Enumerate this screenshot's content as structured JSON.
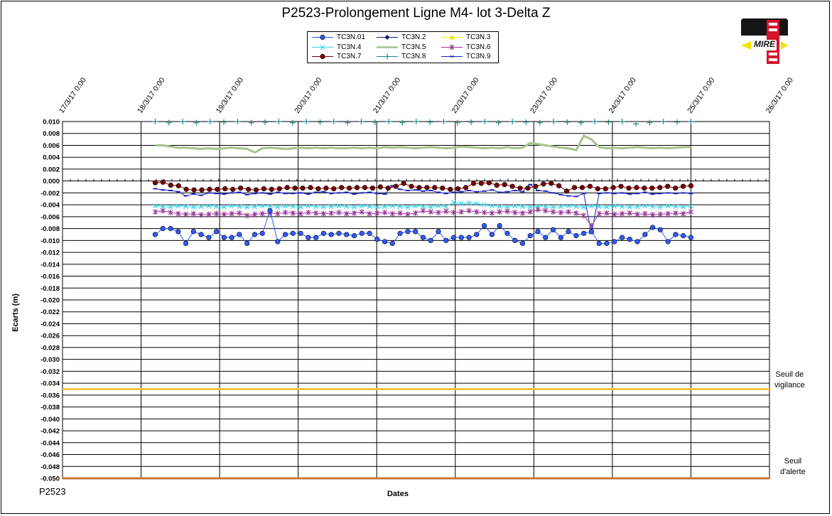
{
  "chart_data": {
    "type": "line",
    "title": "P2523-Prolongement  Ligne  M4- lot 3-Delta Z",
    "xlabel": "Dates",
    "ylabel": "Ecarts (m)",
    "x_ticks": [
      "17/3/17 0:00",
      "18/3/17 0:00",
      "19/3/17 0:00",
      "20/3/17 0:00",
      "21/3/17 0:00",
      "22/3/17 0:00",
      "23/3/17 0:00",
      "24/3/17 0:00",
      "25/3/17 0:00",
      "26/3/17 0:00"
    ],
    "xlim": [
      0,
      9
    ],
    "ylim": [
      -0.05,
      0.01
    ],
    "y_step": 0.002,
    "grid": true,
    "legend_position": "top-center",
    "thresholds": [
      {
        "name": "Seuil de vigilance",
        "label_line1": "Seuil de",
        "label_line2": "vigilance",
        "value": -0.035,
        "color": "#f5c242"
      },
      {
        "name": "Seuil d'alerte",
        "label_line1": "Seuil",
        "label_line2": "d'alerte",
        "value": -0.05,
        "color": "#c8783c"
      }
    ],
    "series": [
      {
        "name": "TC3N.01",
        "color": "#2f5bff",
        "marker": "circle",
        "line": true,
        "y": [
          -0.009,
          -0.008,
          -0.008,
          -0.0085,
          -0.0105,
          -0.0085,
          -0.009,
          -0.0095,
          -0.0085,
          -0.0095,
          -0.0095,
          -0.009,
          -0.0105,
          -0.009,
          -0.0088,
          -0.005,
          -0.0102,
          -0.009,
          -0.0088,
          -0.0088,
          -0.0095,
          -0.0095,
          -0.0088,
          -0.009,
          -0.0088,
          -0.009,
          -0.0092,
          -0.0088,
          -0.0088,
          -0.0098,
          -0.0102,
          -0.0105,
          -0.0088,
          -0.0085,
          -0.0085,
          -0.0095,
          -0.01,
          -0.0085,
          -0.01,
          -0.0095,
          -0.0095,
          -0.0095,
          -0.009,
          -0.0075,
          -0.009,
          -0.0075,
          -0.0088,
          -0.01,
          -0.0105,
          -0.0092,
          -0.0085,
          -0.0095,
          -0.0082,
          -0.0095,
          -0.0085,
          -0.0092,
          -0.0088,
          -0.0085,
          -0.0105,
          -0.0105,
          -0.0102,
          -0.0095,
          -0.0098,
          -0.0102,
          -0.009,
          -0.0078,
          -0.0082,
          -0.0102,
          -0.009,
          -0.0092,
          -0.0095
        ]
      },
      {
        "name": "TC3N.2",
        "color": "#0b1f7a",
        "marker": "diamond",
        "line": true,
        "y": []
      },
      {
        "name": "TC3N.3",
        "color": "#f2e400",
        "marker": "triangle",
        "line": true,
        "y": []
      },
      {
        "name": "TC3N.4",
        "color": "#36d6f0",
        "marker": "x",
        "line": true,
        "y": [
          -0.0042,
          -0.0043,
          -0.0044,
          -0.0042,
          -0.0043,
          -0.0044,
          -0.0043,
          -0.0042,
          -0.0043,
          -0.0044,
          -0.0042,
          -0.0043,
          -0.0044,
          -0.0043,
          -0.0042,
          -0.0043,
          -0.0044,
          -0.0042,
          -0.0043,
          -0.0044,
          -0.0042,
          -0.0043,
          -0.0044,
          -0.0043,
          -0.0042,
          -0.0043,
          -0.0044,
          -0.0042,
          -0.0043,
          -0.0044,
          -0.0043,
          -0.0042,
          -0.0043,
          -0.0044,
          -0.0042,
          -0.0043,
          -0.0044,
          -0.0042,
          -0.0043,
          -0.0036,
          -0.0038,
          -0.0037,
          -0.0038,
          -0.004,
          -0.0042,
          -0.0043,
          -0.0044,
          -0.0042,
          -0.0043,
          -0.0044,
          -0.0042,
          -0.0043,
          -0.0044,
          -0.0043,
          -0.0042,
          -0.0043,
          -0.0044,
          -0.0042,
          -0.0043,
          -0.0044,
          -0.0042,
          -0.0043,
          -0.0044,
          -0.0043,
          -0.0042,
          -0.0043,
          -0.0044,
          -0.0042,
          -0.0043,
          -0.0044,
          -0.0042
        ]
      },
      {
        "name": "TC3N.5",
        "color": "#a4c48a",
        "marker": "none",
        "line": true,
        "y": [
          0.006,
          0.006,
          0.0058,
          0.0056,
          0.0056,
          0.0055,
          0.0054,
          0.0055,
          0.0054,
          0.0055,
          0.0056,
          0.0055,
          0.0054,
          0.0048,
          0.0055,
          0.0056,
          0.0055,
          0.0054,
          0.0055,
          0.0056,
          0.0055,
          0.0056,
          0.0055,
          0.0056,
          0.0055,
          0.0055,
          0.0056,
          0.0055,
          0.0056,
          0.0055,
          0.0057,
          0.0056,
          0.0057,
          0.0056,
          0.0055,
          0.0056,
          0.0057,
          0.0056,
          0.0055,
          0.0056,
          0.0058,
          0.0057,
          0.0056,
          0.0055,
          0.0056,
          0.0055,
          0.0057,
          0.0055,
          0.0056,
          0.0064,
          0.0062,
          0.006,
          0.0058,
          0.0056,
          0.0055,
          0.0052,
          0.0076,
          0.007,
          0.0057,
          0.0055,
          0.0056,
          0.0055,
          0.0056,
          0.0057,
          0.0056,
          0.0055,
          0.0056,
          0.0055,
          0.0056,
          0.0057,
          0.0057
        ]
      },
      {
        "name": "TC3N.6",
        "color": "#993399",
        "marker": "star",
        "line": true,
        "y": [
          -0.0052,
          -0.005,
          -0.0053,
          -0.0055,
          -0.0056,
          -0.0055,
          -0.0057,
          -0.0056,
          -0.0055,
          -0.0056,
          -0.0055,
          -0.0054,
          -0.0058,
          -0.0056,
          -0.0055,
          -0.0054,
          -0.0055,
          -0.0053,
          -0.0054,
          -0.0055,
          -0.0053,
          -0.0054,
          -0.0055,
          -0.0054,
          -0.0053,
          -0.0055,
          -0.0054,
          -0.0052,
          -0.0055,
          -0.0054,
          -0.0053,
          -0.0055,
          -0.0054,
          -0.0056,
          -0.0054,
          -0.005,
          -0.0052,
          -0.0053,
          -0.0051,
          -0.0053,
          -0.0052,
          -0.005,
          -0.0052,
          -0.0053,
          -0.0054,
          -0.0052,
          -0.0051,
          -0.0053,
          -0.0054,
          -0.0052,
          -0.0048,
          -0.005,
          -0.0052,
          -0.0053,
          -0.0052,
          -0.0054,
          -0.0058,
          -0.0075,
          -0.0055,
          -0.0054,
          -0.0056,
          -0.0055,
          -0.0054,
          -0.0056,
          -0.0055,
          -0.0057,
          -0.0056,
          -0.0055,
          -0.0054,
          -0.0055,
          -0.0052
        ]
      },
      {
        "name": "TC3N.7",
        "color": "#7a0000",
        "marker": "circle",
        "line": true,
        "y": [
          -0.0003,
          -0.0002,
          -0.0007,
          -0.0008,
          -0.0014,
          -0.0015,
          -0.0015,
          -0.0014,
          -0.0014,
          -0.0013,
          -0.0014,
          -0.0012,
          -0.0014,
          -0.0015,
          -0.0013,
          -0.0014,
          -0.0013,
          -0.0011,
          -0.0012,
          -0.0012,
          -0.0011,
          -0.0013,
          -0.0012,
          -0.0013,
          -0.0011,
          -0.0012,
          -0.0011,
          -0.0011,
          -0.0012,
          -0.001,
          -0.0012,
          -0.0009,
          -0.0004,
          -0.0009,
          -0.0011,
          -0.0011,
          -0.0011,
          -0.0012,
          -0.0014,
          -0.0013,
          -0.0011,
          -0.0004,
          -0.0004,
          -0.0003,
          -0.0007,
          -0.0006,
          -0.0009,
          -0.0012,
          -0.0012,
          -0.0009,
          -0.0005,
          -0.0004,
          -0.0008,
          -0.0017,
          -0.0011,
          -0.0011,
          -0.0009,
          -0.0013,
          -0.0013,
          -0.0011,
          -0.0009,
          -0.0012,
          -0.0011,
          -0.0012,
          -0.0012,
          -0.0011,
          -0.0009,
          -0.0012,
          -0.0009,
          -0.0008
        ]
      },
      {
        "name": "TC3N.8",
        "color": "#1f8a86",
        "marker": "plus",
        "line": false,
        "y": [
          0.01,
          0.0098,
          0.01,
          0.0098,
          0.01,
          0.0099,
          0.01,
          0.0098,
          0.0099,
          0.01,
          0.0098,
          0.01,
          0.0099,
          0.01,
          0.0098,
          0.01,
          0.0099,
          0.01,
          0.0098,
          0.01,
          0.0099,
          0.01,
          0.0098,
          0.0099,
          0.01,
          0.0098,
          0.01,
          0.0099,
          0.0098,
          0.01,
          0.0099,
          0.0098,
          0.01,
          0.0099,
          0.01,
          0.0096,
          0.0098,
          0.01,
          0.0099,
          0.01
        ]
      },
      {
        "name": "TC3N.9",
        "color": "#1a22c8",
        "marker": "dash",
        "line": true,
        "y": [
          -0.0013,
          -0.0015,
          -0.0016,
          -0.0018,
          -0.0025,
          -0.0022,
          -0.0024,
          -0.002,
          -0.0021,
          -0.0022,
          -0.002,
          -0.0019,
          -0.0023,
          -0.0021,
          -0.002,
          -0.0022,
          -0.0019,
          -0.0021,
          -0.0021,
          -0.002,
          -0.0022,
          -0.0019,
          -0.0018,
          -0.0021,
          -0.002,
          -0.0019,
          -0.0022,
          -0.002,
          -0.0019,
          -0.0021,
          -0.0022,
          -0.0008,
          -0.0014,
          -0.0016,
          -0.0015,
          -0.0017,
          -0.0016,
          -0.0019,
          -0.0021,
          -0.0019,
          -0.0018,
          -0.0016,
          -0.0018,
          -0.0017,
          -0.0015,
          -0.0019,
          -0.0018,
          -0.0016,
          -0.0018,
          -0.0006,
          -0.0016,
          -0.0017,
          -0.002,
          -0.0023,
          -0.0025,
          -0.0026,
          -0.0021,
          -0.0088,
          -0.0021,
          -0.002,
          -0.0021,
          -0.002,
          -0.0022,
          -0.0021,
          -0.0019,
          -0.0022,
          -0.0021,
          -0.002,
          -0.0021,
          -0.002,
          -0.0021
        ]
      }
    ]
  },
  "footer_code": "P2523",
  "logo": {
    "text": "MIRE",
    "color_primary": "#d6142c",
    "color_dark": "#151515",
    "color_yellow": "#f2e400"
  }
}
